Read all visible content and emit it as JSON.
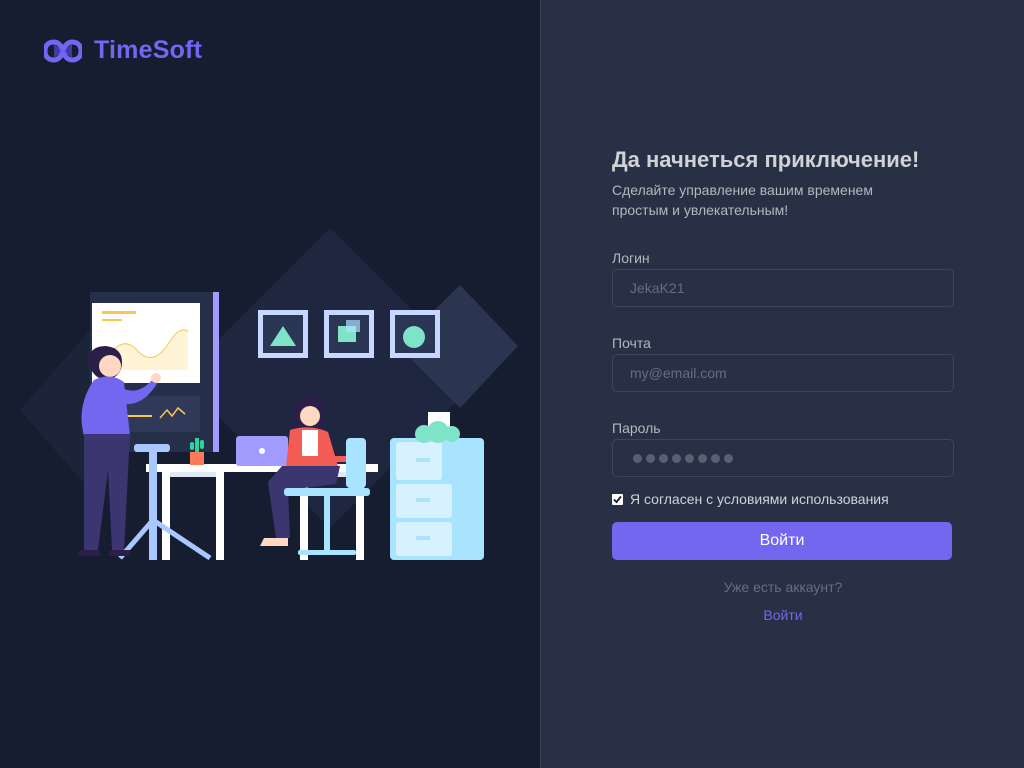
{
  "brand": {
    "name": "TimeSoft",
    "color": "#7367f0",
    "logo_icon": "infinity-logo-icon"
  },
  "form": {
    "title": "Да начнеться приключение!",
    "subtitle": "Сделайте управление вашим временем простым и увлекательным!",
    "login": {
      "label": "Логин",
      "placeholder": "JekaK21"
    },
    "email": {
      "label": "Почта",
      "placeholder": "my@email.com"
    },
    "password": {
      "label": "Пароль",
      "masked_char_count": 8
    },
    "terms": {
      "label": "Я согласен с условиями использования",
      "checked": true
    },
    "submit_label": "Войти",
    "have_account_text": "Уже есть аккаунт?",
    "signin_link": "Войти"
  },
  "colors": {
    "accent": "#7367f0",
    "left_bg": "#161d31",
    "right_bg": "#283046"
  },
  "illustration": {
    "description_icon": "office-workers-illustration"
  }
}
